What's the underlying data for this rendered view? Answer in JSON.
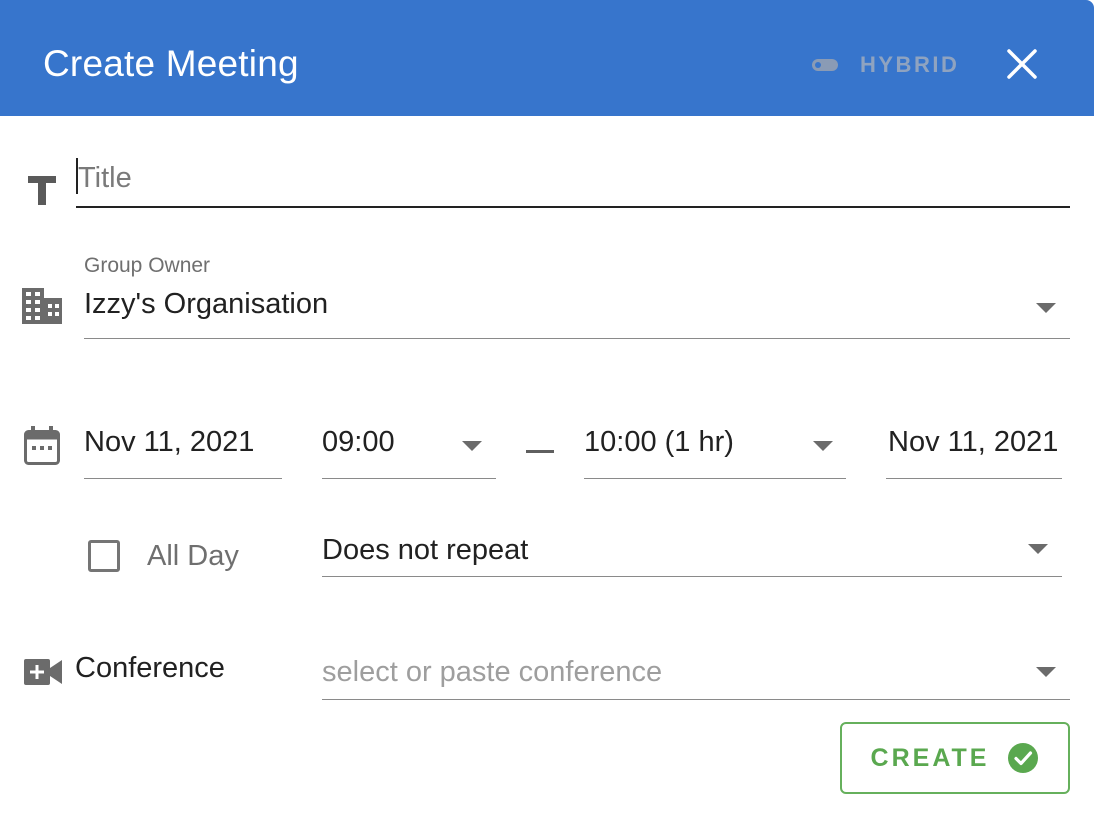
{
  "header": {
    "title": "Create Meeting",
    "hybrid_label": "HYBRID",
    "close_icon": "close-icon",
    "toggle_icon": "toggle-icon",
    "color": "#3775cc"
  },
  "title_field": {
    "placeholder": "Title",
    "value": "",
    "icon": "text-title-icon"
  },
  "group_owner": {
    "label": "Group Owner",
    "value": "Izzy's Organisation",
    "icon": "building-icon"
  },
  "schedule": {
    "icon": "calendar-icon",
    "start_date": "Nov 11, 2021",
    "start_time": "09:00",
    "end_time": "10:00 (1 hr)",
    "end_date": "Nov 11, 2021",
    "all_day_label": "All Day",
    "all_day_checked": false,
    "repeat": "Does not repeat"
  },
  "conference": {
    "label": "Conference",
    "placeholder": "select or paste conference",
    "icon": "video-add-icon"
  },
  "actions": {
    "create_label": "CREATE",
    "create_icon": "check-circle-icon",
    "create_color": "#5aa84f"
  }
}
